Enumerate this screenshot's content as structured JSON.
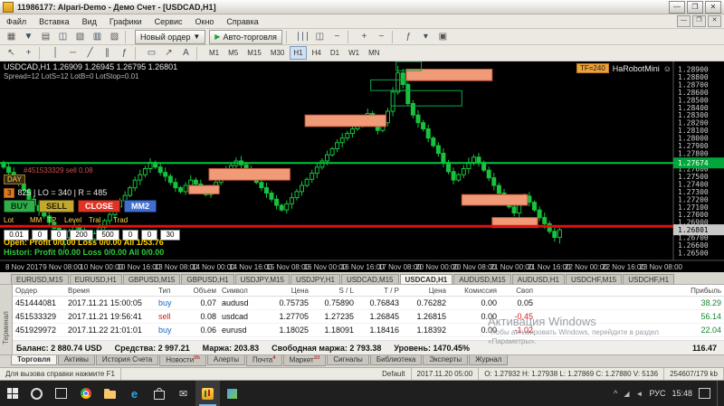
{
  "window": {
    "title": "11986177: Alpari-Demo - Демо Счет - [USDCAD,H1]",
    "controls": {
      "min": "—",
      "max": "❐",
      "close": "✕"
    },
    "mdi": {
      "min": "—",
      "max": "❐",
      "close": "✕"
    }
  },
  "menu": {
    "items": [
      "Файл",
      "Вставка",
      "Вид",
      "Графики",
      "Сервис",
      "Окно",
      "Справка"
    ]
  },
  "toolbar": {
    "active_timeframe": "H1",
    "row1": [
      {
        "t": "i",
        "name": "new-chart-icon",
        "g": "▦"
      },
      {
        "t": "i",
        "name": "profiles-icon",
        "g": "▼"
      },
      {
        "t": "i",
        "name": "market-watch-icon",
        "g": "▤"
      },
      {
        "t": "i",
        "name": "data-window-icon",
        "g": "◫"
      },
      {
        "t": "i",
        "name": "navigator-icon",
        "g": "▧"
      },
      {
        "t": "i",
        "name": "terminal-panel-icon",
        "g": "▥"
      },
      {
        "t": "i",
        "name": "strategy-tester-icon",
        "g": "▨"
      },
      {
        "t": "s"
      },
      {
        "t": "b",
        "name": "new-order-button",
        "label": "Новый ордер",
        "g": "▼",
        "gpos": "r"
      },
      {
        "t": "b",
        "name": "autotrade-button",
        "label": "Авто-торговля",
        "g": "▶",
        "gcolor": "#1fa32a"
      },
      {
        "t": "s"
      },
      {
        "t": "i",
        "name": "chart-bars-icon",
        "g": "∣∣∣"
      },
      {
        "t": "i",
        "name": "chart-candles-icon",
        "g": "◫"
      },
      {
        "t": "i",
        "name": "chart-line-icon",
        "g": "~"
      },
      {
        "t": "s"
      },
      {
        "t": "i",
        "name": "zoom-in-icon",
        "g": "+"
      },
      {
        "t": "i",
        "name": "zoom-out-icon",
        "g": "−"
      },
      {
        "t": "s"
      },
      {
        "t": "i",
        "name": "indicators-icon",
        "g": "ƒ"
      },
      {
        "t": "i",
        "name": "periods-icon",
        "g": "▾"
      },
      {
        "t": "i",
        "name": "templates-icon",
        "g": "▣"
      }
    ],
    "row2": [
      {
        "t": "i",
        "name": "cursor-icon",
        "g": "↖"
      },
      {
        "t": "i",
        "name": "crosshair-icon",
        "g": "+"
      },
      {
        "t": "s"
      },
      {
        "t": "i",
        "name": "vertical-line-icon",
        "g": "│"
      },
      {
        "t": "i",
        "name": "horizontal-line-icon",
        "g": "─"
      },
      {
        "t": "i",
        "name": "trendline-icon",
        "g": "╱"
      },
      {
        "t": "i",
        "name": "channel-icon",
        "g": "∥"
      },
      {
        "t": "i",
        "name": "fibonacci-icon",
        "g": "ƒ"
      },
      {
        "t": "s"
      },
      {
        "t": "i",
        "name": "shapes-icon",
        "g": "▭"
      },
      {
        "t": "i",
        "name": "arrow-tool-icon",
        "g": "↗"
      },
      {
        "t": "i",
        "name": "text-tool-icon",
        "g": "A"
      },
      {
        "t": "s"
      },
      {
        "t": "tf",
        "label": "M1"
      },
      {
        "t": "tf",
        "label": "M5"
      },
      {
        "t": "tf",
        "label": "M15"
      },
      {
        "t": "tf",
        "label": "M30"
      },
      {
        "t": "tf",
        "label": "H1"
      },
      {
        "t": "tf",
        "label": "H4"
      },
      {
        "t": "tf",
        "label": "D1"
      },
      {
        "t": "tf",
        "label": "W1"
      },
      {
        "t": "tf",
        "label": "MN"
      }
    ]
  },
  "chart": {
    "symbol_line": "USDCAD,H1  1.26909 1.26945 1.26795 1.26801",
    "info_line": "Spread=12  LotS=12  LotB=0  LotStop=0.01",
    "ea_name": "HaRobotMini",
    "ea_face": "☺",
    "tf_badge": "TF=240",
    "order_label": "#451533329 sell 0.08",
    "day_label": "DAY",
    "range_num": "3",
    "range_label": "825 | LO = 340 | R = 485",
    "buttons": [
      {
        "label": "BUY",
        "bg": "#2fae4a",
        "fg": "#0a2a0f"
      },
      {
        "label": "SELL",
        "bg": "#c3a82e",
        "fg": "#241f05"
      },
      {
        "label": "CLOSE",
        "bg": "#e03324",
        "fg": "#ffffff"
      },
      {
        "label": "MM2",
        "bg": "#3f6fd0",
        "fg": "#ffffff"
      }
    ],
    "param_labels": [
      "Lot",
      "MM",
      "TP",
      "Level",
      "Tral",
      "Trad"
    ],
    "param_values": [
      "0.01",
      "0",
      "0",
      "200",
      "500",
      "0",
      "0",
      "30"
    ],
    "open_line": "Open:  Profit 0/0.00  Loss 0/0.00  All 1/53.76",
    "history_line": "Histori: Profit 0/0.00  Loss 0/0.00  All 0/0.00"
  },
  "chart_data": {
    "type": "candlestick",
    "symbol": "USDCAD",
    "timeframe": "H1",
    "price_min": 1.264,
    "price_max": 1.29,
    "tick_step": 0.001,
    "first_open": 1.2768,
    "closes": [
      1.2762,
      1.2755,
      1.2748,
      1.274,
      1.2732,
      1.272,
      1.2712,
      1.2705,
      1.2698,
      1.269,
      1.2682,
      1.2675,
      1.267,
      1.2678,
      1.2685,
      1.268,
      1.2672,
      1.2668,
      1.2675,
      1.2683,
      1.2692,
      1.27,
      1.271,
      1.2718,
      1.2725,
      1.2735,
      1.2745,
      1.2752,
      1.276,
      1.2768,
      1.2762,
      1.2755,
      1.275,
      1.2742,
      1.2735,
      1.273,
      1.2738,
      1.2745,
      1.274,
      1.2732,
      1.2726,
      1.2734,
      1.2742,
      1.275,
      1.2758,
      1.2764,
      1.277,
      1.2765,
      1.2758,
      1.275,
      1.2742,
      1.2735,
      1.2728,
      1.272,
      1.2712,
      1.2706,
      1.2714,
      1.2722,
      1.273,
      1.2738,
      1.2746,
      1.2754,
      1.2762,
      1.277,
      1.2778,
      1.2786,
      1.2794,
      1.28,
      1.2806,
      1.2812,
      1.2818,
      1.2825,
      1.2832,
      1.282,
      1.281,
      1.282,
      1.2835,
      1.286,
      1.2885,
      1.287,
      1.2845,
      1.283,
      1.282,
      1.2812,
      1.28,
      1.279,
      1.278,
      1.2768,
      1.2756,
      1.2745,
      1.2752,
      1.276,
      1.2768,
      1.2775,
      1.2768,
      1.2758,
      1.2748,
      1.2738,
      1.2728,
      1.2718,
      1.271,
      1.2702,
      1.2716,
      1.2724,
      1.2716,
      1.2706,
      1.2696,
      1.2688,
      1.2678,
      1.267,
      1.26801
    ],
    "wick_overrides": {
      "12": {
        "l": 1.2656
      },
      "78": {
        "h": 1.28945
      },
      "110": {
        "l": 1.2662
      }
    },
    "green_line": 1.27674,
    "red_line": 1.26845,
    "tags": {
      "green": 1.27674,
      "current": 1.26801
    },
    "zones_orange": [
      [
        37,
        43,
        1.2727,
        1.2738
      ],
      [
        41,
        57,
        1.2745,
        1.276
      ],
      [
        60,
        76,
        1.2815,
        1.283
      ],
      [
        80,
        97,
        1.2875,
        1.289
      ],
      [
        91,
        104,
        1.2712,
        1.2726
      ],
      [
        97,
        106,
        1.2683,
        1.2696
      ]
    ],
    "zones_green": [
      [
        73,
        80,
        1.2862,
        1.2876
      ],
      [
        77,
        91,
        1.2842,
        1.2862
      ],
      [
        78,
        83,
        1.2888,
        1.29
      ]
    ],
    "x_labels": [
      "8 Nov 2017",
      "9 Nov 08:00",
      "10 Nov 00:00",
      "10 Nov 16:00",
      "13 Nov 08:00",
      "14 Nov 00:00",
      "14 Nov 16:00",
      "15 Nov 08:00",
      "16 Nov 00:00",
      "16 Nov 16:00",
      "17 Nov 08:00",
      "20 Nov 00:00",
      "20 Nov 08:00",
      "21 Nov 00:00",
      "21 Nov 16:00",
      "22 Nov 00:00",
      "22 Nov 16:00",
      "23 Nov 08:00"
    ]
  },
  "symbol_tabs": {
    "active": "USDCAD,H1",
    "items": [
      "EURUSD,M15",
      "EURUSD,H1",
      "GBPUSD,M15",
      "GBPUSD,H1",
      "USDJPY,M15",
      "USDJPY,H1",
      "USDCAD,M15",
      "USDCAD,H1",
      "AUDUSD,M15",
      "AUDUSD,H1",
      "USDCHF,M15",
      "USDCHF,H1"
    ]
  },
  "terminal": {
    "side_label": "Терминал",
    "columns": [
      "Ордер",
      "Время",
      "Тип",
      "Объем",
      "Символ",
      "Цена",
      "S / L",
      "T / P",
      "Цена",
      "Комиссия",
      "Своп",
      "Прибыль"
    ],
    "orders": [
      {
        "id": "451444081",
        "time": "2017.11.21 15:00:05",
        "type": "buy",
        "volume": "0.07",
        "symbol": "audusd",
        "price": "0.75735",
        "sl": "0.75890",
        "tp": "0.76843",
        "price2": "0.76282",
        "commission": "0.00",
        "swap": "0.05",
        "profit": "38.29"
      },
      {
        "id": "451533329",
        "time": "2017.11.21 19:56:41",
        "type": "sell",
        "volume": "0.08",
        "symbol": "usdcad",
        "price": "1.27705",
        "sl": "1.27235",
        "tp": "1.26845",
        "price2": "1.26815",
        "commission": "0.00",
        "swap": "-0.45",
        "profit": "56.14"
      },
      {
        "id": "451929972",
        "time": "2017.11.22 21:01:01",
        "type": "buy",
        "volume": "0.06",
        "symbol": "eurusd",
        "price": "1.18025",
        "sl": "1.18091",
        "tp": "1.18416",
        "price2": "1.18392",
        "commission": "0.00",
        "swap": "-1.02",
        "profit": "22.04"
      }
    ],
    "balance_line": {
      "balance": "Баланс: 2 880.74 USD",
      "equity": "Средства: 2 997.21",
      "margin": "Маржа: 203.83",
      "free": "Свободная маржа: 2 793.38",
      "level": "Уровень: 1470.45%",
      "profit": "116.47"
    },
    "active_tab": "Торговля",
    "tabs": [
      {
        "label": "Торговля"
      },
      {
        "label": "Активы"
      },
      {
        "label": "История Счета"
      },
      {
        "label": "Новости",
        "badge": "95"
      },
      {
        "label": "Алерты"
      },
      {
        "label": "Почта",
        "badge": "4"
      },
      {
        "label": "Маркет",
        "badge": "33"
      },
      {
        "label": "Сигналы"
      },
      {
        "label": "Библиотека"
      },
      {
        "label": "Эксперты"
      },
      {
        "label": "Журнал"
      }
    ]
  },
  "status_bar": {
    "help": "Для вызова справки нажмите F1",
    "profile": "Default",
    "time": "2017.11.20 05:00",
    "ohlcv": "O: 1.27932  H: 1.27938  L: 1.27869  C: 1.27880  V: 5136",
    "size": "254607/179 kb"
  },
  "watermark": {
    "line1": "Активация Windows",
    "line2": "Чтобы активировать Windows, перейдите в раздел «Параметры»."
  },
  "taskbar": {
    "icons": [
      {
        "name": "start-button",
        "kind": "win"
      },
      {
        "name": "search-button",
        "kind": "ring"
      },
      {
        "name": "task-view-button",
        "kind": "sq"
      },
      {
        "name": "chrome-icon",
        "kind": "chrome"
      },
      {
        "name": "explorer-icon",
        "kind": "folder"
      },
      {
        "name": "edge-icon",
        "kind": "edge",
        "g": "e"
      },
      {
        "name": "store-icon",
        "kind": "bag"
      },
      {
        "name": "mail-icon",
        "kind": "mail",
        "g": "✉"
      },
      {
        "name": "mt4-taskbar-icon",
        "kind": "mt4",
        "active": true
      },
      {
        "name": "photos-icon",
        "kind": "photos"
      }
    ],
    "tray": {
      "hidden": "^",
      "net": "◢",
      "vol": "◄",
      "lang": "РУС",
      "time": "15:48"
    }
  }
}
